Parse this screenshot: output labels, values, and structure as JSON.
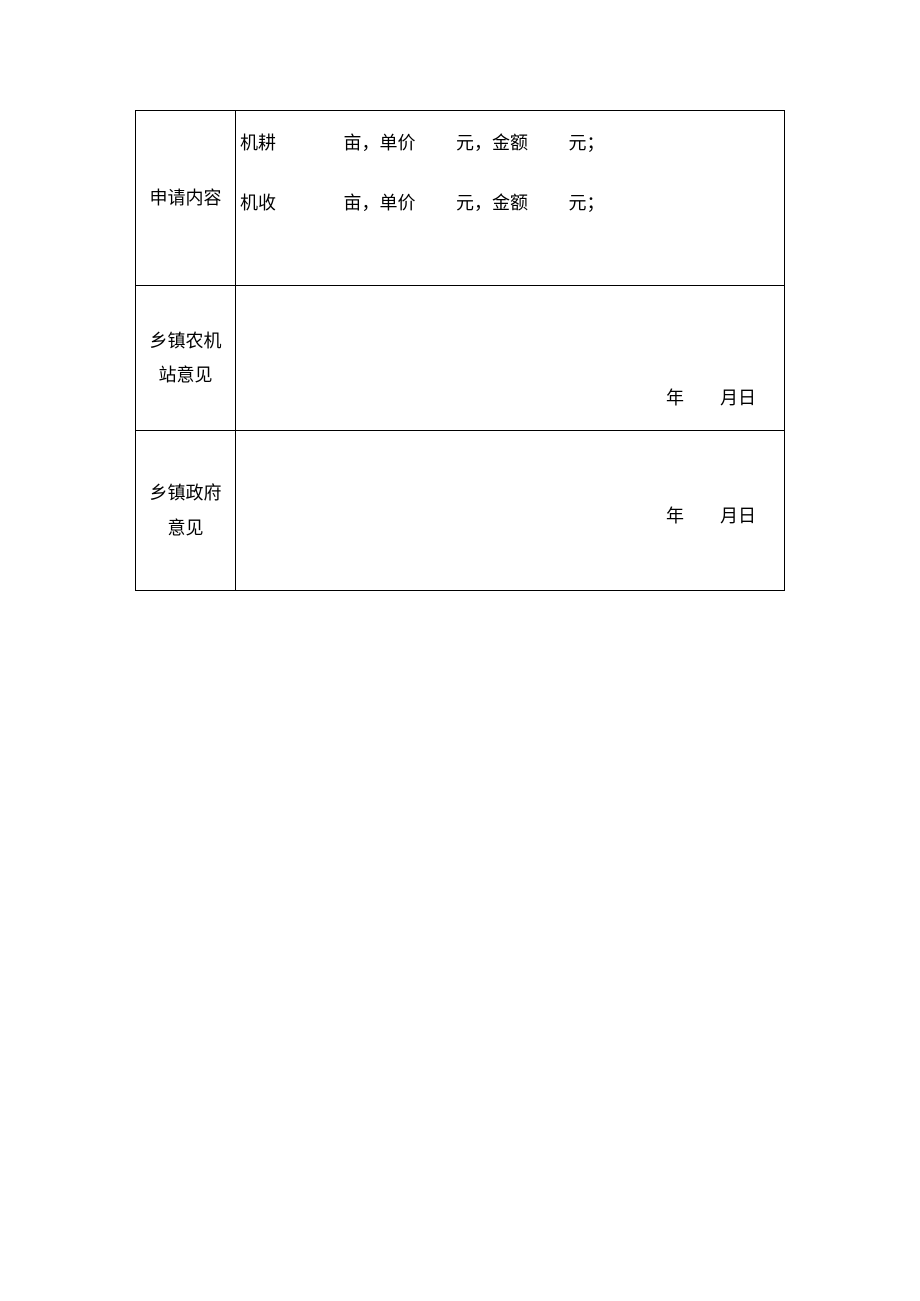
{
  "rows": {
    "application": {
      "header": "申请内容",
      "line1": {
        "label": "机耕",
        "area_unit": "亩，单价",
        "price_unit": "元，金额",
        "amount_unit": "元；"
      },
      "line2": {
        "label": "机收",
        "area_unit": "亩，单价",
        "price_unit": "元，金额",
        "amount_unit": "元；"
      }
    },
    "station": {
      "header": "乡镇农机站意见",
      "date": {
        "year": "年",
        "month_day": "月日"
      }
    },
    "government": {
      "header": "乡镇政府意见",
      "date": {
        "year": "年",
        "month_day": "月日"
      }
    }
  }
}
